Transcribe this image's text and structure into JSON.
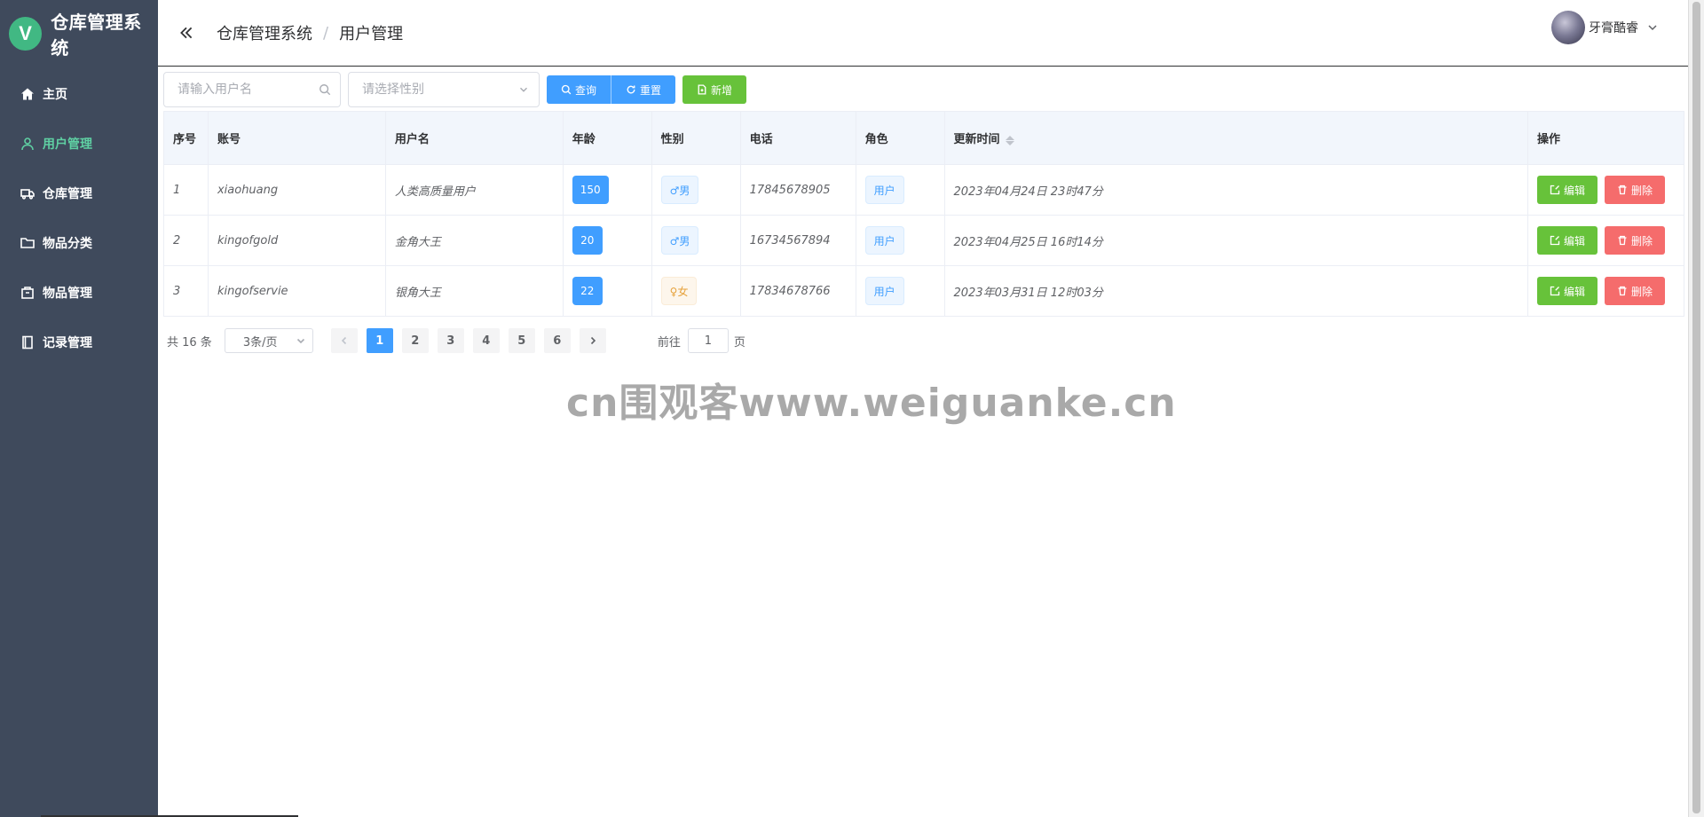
{
  "app": {
    "logo_letter": "V",
    "title": "仓库管理系统"
  },
  "sidebar": {
    "items": [
      {
        "label": "主页",
        "icon": "home-icon"
      },
      {
        "label": "用户管理",
        "icon": "user-icon"
      },
      {
        "label": "仓库管理",
        "icon": "truck-icon"
      },
      {
        "label": "物品分类",
        "icon": "folder-icon"
      },
      {
        "label": "物品管理",
        "icon": "box-icon"
      },
      {
        "label": "记录管理",
        "icon": "notebook-icon"
      }
    ],
    "active_index": 1
  },
  "header": {
    "breadcrumb": [
      "仓库管理系统",
      "用户管理"
    ],
    "separator": "/",
    "username": "牙膏酷睿"
  },
  "toolbar": {
    "username_placeholder": "请输入用户名",
    "gender_placeholder": "请选择性别",
    "query_label": "查询",
    "reset_label": "重置",
    "add_label": "新增"
  },
  "table": {
    "columns": [
      "序号",
      "账号",
      "用户名",
      "年龄",
      "性别",
      "电话",
      "角色",
      "更新时间",
      "操作"
    ],
    "rows": [
      {
        "no": "1",
        "account": "xiaohuang",
        "name": "人类高质量用户",
        "age": "150",
        "gender": "♂男",
        "gender_type": "male",
        "phone": "17845678905",
        "role": "用户",
        "updated": "2023年04月24日 23时47分"
      },
      {
        "no": "2",
        "account": "kingofgold",
        "name": "金角大王",
        "age": "20",
        "gender": "♂男",
        "gender_type": "male",
        "phone": "16734567894",
        "role": "用户",
        "updated": "2023年04月25日 16时14分"
      },
      {
        "no": "3",
        "account": "kingofservie",
        "name": "银角大王",
        "age": "22",
        "gender": "♀女",
        "gender_type": "female",
        "phone": "17834678766",
        "role": "用户",
        "updated": "2023年03月31日 12时03分"
      }
    ],
    "edit_label": "编辑",
    "delete_label": "删除"
  },
  "pagination": {
    "total_text": "共 16 条",
    "page_size": "3条/页",
    "pages": [
      "1",
      "2",
      "3",
      "4",
      "5",
      "6"
    ],
    "current_page": "1",
    "goto_label": "前往",
    "goto_value": "1",
    "page_suffix": "页"
  },
  "watermark": "cn围观客www.weiguanke.cn",
  "colors": {
    "sidebar": "#3f4a5c",
    "active_menu": "#5fd0a3",
    "primary": "#409eff",
    "success": "#67c23a",
    "danger": "#f56c6c"
  }
}
